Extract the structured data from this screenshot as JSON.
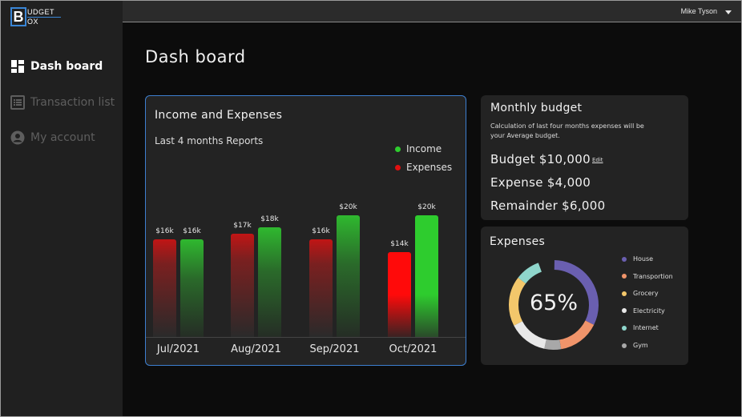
{
  "app": {
    "logo_letter": "B",
    "logo_line1": "UDGET",
    "logo_line2": "OX"
  },
  "sidebar": {
    "items": [
      {
        "label": "Dash board",
        "icon": "dashboard-icon",
        "active": true
      },
      {
        "label": "Transaction list",
        "icon": "list-icon",
        "active": false
      },
      {
        "label": "My account",
        "icon": "account-icon",
        "active": false
      }
    ]
  },
  "header": {
    "user_name": "Mike Tyson"
  },
  "page": {
    "title": "Dash board"
  },
  "income_card": {
    "title": "Income and Expenses",
    "subtitle": "Last 4 months Reports",
    "legend": {
      "income": "Income",
      "expenses": "Expenses"
    }
  },
  "chart_data": {
    "type": "bar",
    "categories": [
      "Jul/2021",
      "Aug/2021",
      "Sep/2021",
      "Oct/2021"
    ],
    "series": [
      {
        "name": "Expenses",
        "values": [
          16,
          17,
          16,
          14
        ],
        "labels": [
          "$16k",
          "$17k",
          "$16k",
          "$14k"
        ]
      },
      {
        "name": "Income",
        "values": [
          16,
          18,
          20,
          20
        ],
        "labels": [
          "$16k",
          "$18k",
          "$20k",
          "$20k"
        ]
      }
    ],
    "title": "Income and Expenses",
    "subtitle": "Last 4 months Reports",
    "legend_position": "top-right",
    "grid": false,
    "colors": {
      "Income": "#2ecc2e",
      "Expenses": "#e01010"
    },
    "highlighted_category": "Oct/2021"
  },
  "monthly_budget": {
    "title": "Monthly budget",
    "description": "Calculation of last four months expenses will be your Average budget.",
    "budget_text": "Budget  $10,000",
    "edit_label": "Edit",
    "expense_text": "Expense $4,000",
    "remainder_text": "Remainder $6,000"
  },
  "expenses": {
    "title": "Expenses",
    "center_label": "65%",
    "categories": [
      {
        "name": "House",
        "color": "#6a5fb0",
        "share": 0.32
      },
      {
        "name": "Transportion",
        "color": "#f0946a",
        "share": 0.15
      },
      {
        "name": "Grocery",
        "color": "#f3c76b",
        "share": 0.18
      },
      {
        "name": "Electricity",
        "color": "#e8e8e8",
        "share": 0.14
      },
      {
        "name": "Internet",
        "color": "#8fd6cc",
        "share": 0.09
      },
      {
        "name": "Gym",
        "color": "#a8a8a8",
        "share": 0.06
      }
    ]
  }
}
